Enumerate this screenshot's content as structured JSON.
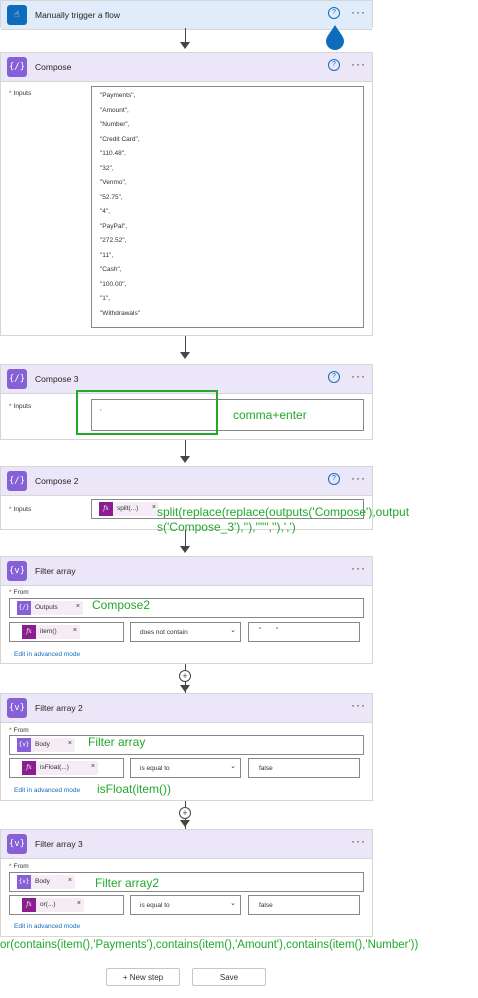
{
  "trigger": {
    "title": "Manually trigger a flow",
    "help_icon": "help-icon",
    "more_icon": "more-options-icon"
  },
  "compose": {
    "title": "Compose",
    "inputs_label": "Inputs",
    "lines": [
      "\"Payments\",",
      "\"Amount\",",
      "\"Number\",",
      "\"Credit Card\",",
      "\"110.48\",",
      "\"32\",",
      "\"Venmo\",",
      "\"52.75\",",
      "\"4\",",
      "\"PayPal\",",
      "\"272.52\",",
      "\"11\",",
      "\"Cash\",",
      "\"100.00\",",
      "\"1\",",
      "\"Withdrawals\""
    ]
  },
  "compose3": {
    "title": "Compose 3",
    "inputs_label": "Inputs",
    "value": ",",
    "annotation": "comma+enter"
  },
  "compose2": {
    "title": "Compose 2",
    "inputs_label": "Inputs",
    "token": "split(...)",
    "annotation_line1": "split(replace(replace(outputs('Compose'),output",
    "annotation_line2": "s('Compose_3'),''),'\"\"',''),',')"
  },
  "filter1": {
    "title": "Filter array",
    "from_label": "From",
    "from_token": "Outputs",
    "annotation": "Compose2",
    "left_token": "item()",
    "operator": "does not contain",
    "right_value": "\"        \"",
    "advanced": "Edit in advanced mode"
  },
  "filter2": {
    "title": "Filter array 2",
    "from_label": "From",
    "from_token": "Body",
    "annotation": "Filter array",
    "left_token": "isFloat(...)",
    "operator": "is equal to",
    "right_value": "false",
    "advanced": "Edit in advanced mode",
    "annotation2": "isFloat(item())"
  },
  "filter3": {
    "title": "Filter array 3",
    "from_label": "From",
    "from_token": "Body",
    "annotation": "Filter array2",
    "left_token": "or(...)",
    "operator": "is equal to",
    "right_value": "false",
    "advanced": "Edit in advanced mode"
  },
  "bottom_annotation": "or(contains(item(),'Payments'),contains(item(),'Amount'),contains(item(),'Number'))",
  "buttons": {
    "new_step": "+ New step",
    "save": "Save"
  },
  "colors": {
    "accent": "#8660d6",
    "trigger": "#0f6cbd",
    "annotation": "#22a82a",
    "highlight_box": "#22a82a",
    "expression": "#8a1d8f"
  }
}
